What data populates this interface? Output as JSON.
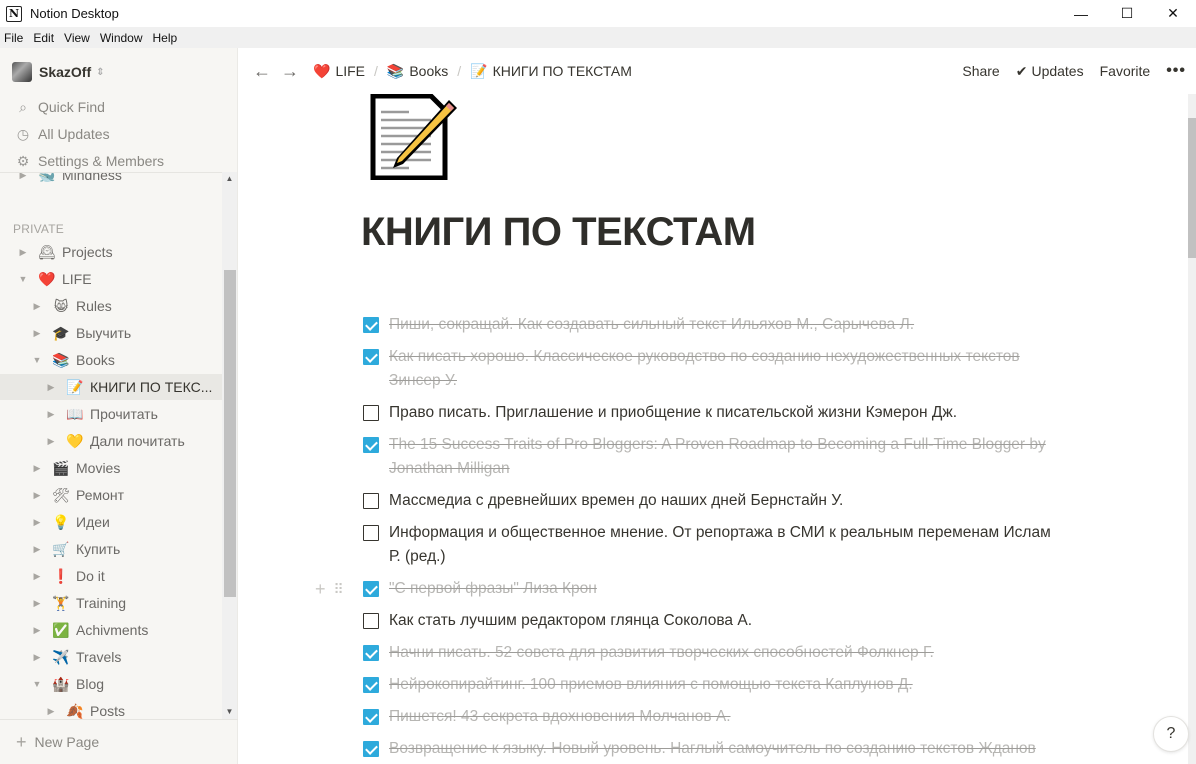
{
  "window": {
    "title": "Notion Desktop",
    "app_icon": "N",
    "controls": {
      "minimize": "—",
      "maximize": "☐",
      "close": "✕"
    }
  },
  "menubar": [
    "File",
    "Edit",
    "View",
    "Window",
    "Help"
  ],
  "sidebar": {
    "workspace": "SkazOff",
    "actions": [
      {
        "label": "Quick Find",
        "icon": "search-icon",
        "glyph": "⌕"
      },
      {
        "label": "All Updates",
        "icon": "clock-icon",
        "glyph": "◷"
      },
      {
        "label": "Settings & Members",
        "icon": "gear-icon",
        "glyph": "⚙"
      }
    ],
    "partial_item": {
      "label": "Mindness",
      "emoji": "🐋"
    },
    "section_label": "PRIVATE",
    "tree": [
      {
        "label": "Projects",
        "emoji": "🕰",
        "level": 0,
        "expanded": false
      },
      {
        "label": "LIFE",
        "emoji": "❤️",
        "level": 0,
        "expanded": true
      },
      {
        "label": "Rules",
        "emoji": "😸",
        "level": 1,
        "expanded": false
      },
      {
        "label": "Выучить",
        "emoji": "🎓",
        "level": 1,
        "expanded": false
      },
      {
        "label": "Books",
        "emoji": "📚",
        "level": 1,
        "expanded": true
      },
      {
        "label": "КНИГИ ПО ТЕКС...",
        "emoji": "📝",
        "level": 2,
        "expanded": false,
        "active": true
      },
      {
        "label": "Прочитать",
        "emoji": "📖",
        "level": 2,
        "expanded": false
      },
      {
        "label": "Дали почитать",
        "emoji": "💛",
        "level": 2,
        "expanded": false
      },
      {
        "label": "Movies",
        "emoji": "🎬",
        "level": 1,
        "expanded": false
      },
      {
        "label": "Ремонт",
        "emoji": "🛠",
        "level": 1,
        "expanded": false
      },
      {
        "label": "Идеи",
        "emoji": "💡",
        "level": 1,
        "expanded": false
      },
      {
        "label": "Купить",
        "emoji": "🛒",
        "level": 1,
        "expanded": false
      },
      {
        "label": "Do it",
        "emoji": "❗",
        "level": 1,
        "expanded": false
      },
      {
        "label": "Training",
        "emoji": "🏋",
        "level": 1,
        "expanded": false
      },
      {
        "label": "Achivments",
        "emoji": "✅",
        "level": 1,
        "expanded": false
      },
      {
        "label": "Travels",
        "emoji": "✈️",
        "level": 1,
        "expanded": false
      },
      {
        "label": "Blog",
        "emoji": "🏰",
        "level": 1,
        "expanded": true
      },
      {
        "label": "Posts",
        "emoji": "🍂",
        "level": 2,
        "expanded": false
      }
    ],
    "new_page": "New Page"
  },
  "topbar": {
    "breadcrumb": [
      {
        "label": "LIFE",
        "emoji": "❤️"
      },
      {
        "label": "Books",
        "emoji": "📚"
      },
      {
        "label": "КНИГИ ПО ТЕКСТАМ",
        "emoji": "📝"
      }
    ],
    "share": "Share",
    "updates": "Updates",
    "favorite": "Favorite",
    "more": "•••"
  },
  "page": {
    "icon": "memo-icon",
    "title": "КНИГИ ПО ТЕКСТАМ",
    "todos": [
      {
        "text": "Пиши, сокращай. Как создавать сильный текст Ильяхов М., Сарычева Л.",
        "checked": true
      },
      {
        "text": "Как писать хорошо. Классическое руководство по созданию нехудожественных текстов Зинсер У.",
        "checked": true
      },
      {
        "text": "Право писать. Приглашение и приобщение к писательской жизни Кэмерон Дж.",
        "checked": false
      },
      {
        "text": "The 15 Success Traits of Pro Bloggers: A Proven Roadmap to Becoming a Full-Time Blogger by Jonathan Milligan",
        "checked": true
      },
      {
        "text": "Массмедиа с древнейших времен до наших дней Бернстайн У.",
        "checked": false
      },
      {
        "text": "Информация и общественное мнение. От репортажа в СМИ к реальным переменам Ислам Р. (ред.)",
        "checked": false
      },
      {
        "text": "\"С первой фразы\" Лиза Крон",
        "checked": true,
        "hovered": true
      },
      {
        "text": "Как стать лучшим редактором глянца Соколова А.",
        "checked": false
      },
      {
        "text": "Начни писать. 52 совета для развития творческих способностей Фолкнер Г.",
        "checked": true
      },
      {
        "text": "Нейрокопирайтинг. 100 приемов влияния с помощью текста Каплунов Д.",
        "checked": true
      },
      {
        "text": "Пишется! 43 секрета вдохновения Молчанов А.",
        "checked": true
      },
      {
        "text": "Возвращение к языку. Новый уровень. Наглый самоучитель по созданию текстов Жданов",
        "checked": true
      }
    ]
  },
  "help": "?",
  "colors": {
    "checkbox_checked": "#2eaadc",
    "sidebar_bg": "#f7f6f3",
    "text": "#37352f"
  }
}
